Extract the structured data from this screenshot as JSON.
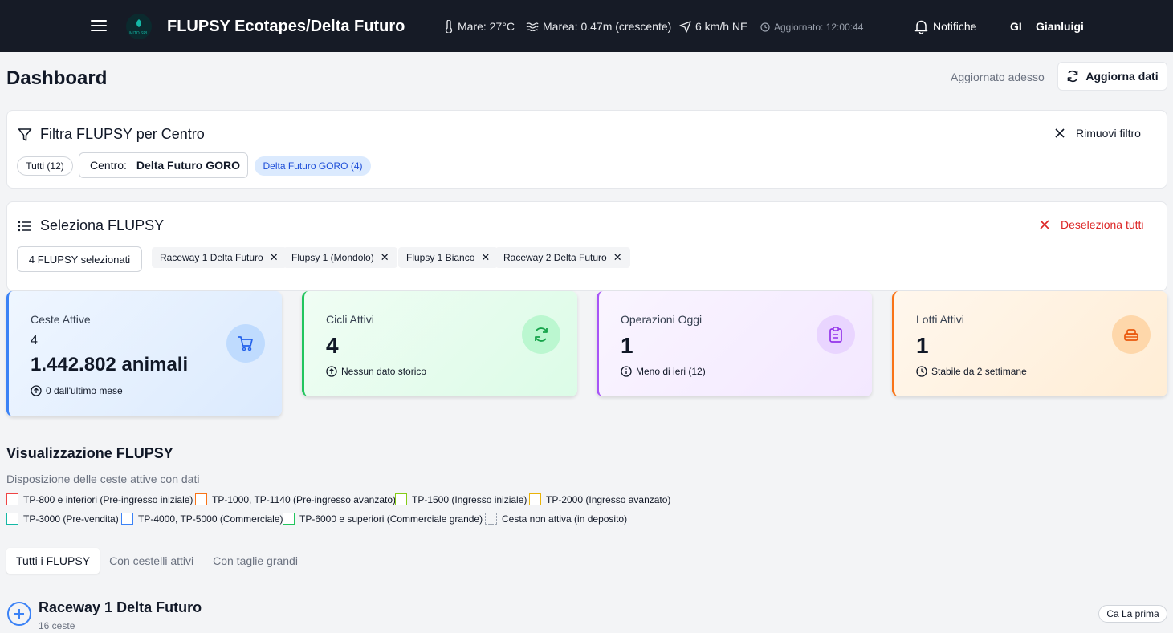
{
  "topbar": {
    "title": "FLUPSY Ecotapes/Delta Futuro",
    "logo_text": "MITO SRL",
    "sea_temp": "Mare: 27°C",
    "tide": "Marea: 0.47m (crescente)",
    "wind": "6 km/h NE",
    "updated": "Aggiornato: 12:00:44",
    "notifications": "Notifiche",
    "user_initials": "GI",
    "user_name": "Gianluigi"
  },
  "header": {
    "title": "Dashboard",
    "updated_now": "Aggiornato adesso",
    "refresh_label": "Aggiorna dati"
  },
  "filter": {
    "title": "Filtra FLUPSY per Centro",
    "remove_label": "Rimuovi filtro",
    "all_label": "Tutti (12)",
    "center_label": "Centro:",
    "center_value": "Delta Futuro GORO",
    "active_badge": "Delta Futuro GORO (4)"
  },
  "select": {
    "title": "Seleziona FLUPSY",
    "deselect_label": "Deseleziona tutti",
    "count_label": "4 FLUPSY selezionati",
    "chips": [
      "Raceway 1 Delta Futuro",
      "Flupsy 1 (Mondolo)",
      "Flupsy 1 Bianco",
      "Raceway 2 Delta Futuro"
    ]
  },
  "stats": {
    "ceste": {
      "label": "Ceste Attive",
      "value": "4",
      "animals": "1.442.802 animali",
      "sub": "0 dall'ultimo mese"
    },
    "cicli": {
      "label": "Cicli Attivi",
      "value": "4",
      "sub": "Nessun dato storico"
    },
    "operazioni": {
      "label": "Operazioni Oggi",
      "value": "1",
      "sub": "Meno di ieri (12)"
    },
    "lotti": {
      "label": "Lotti Attivi",
      "value": "1",
      "sub": "Stabile da 2 settimane"
    }
  },
  "viz": {
    "title": "Visualizzazione FLUPSY",
    "subtitle": "Disposizione delle ceste attive con dati",
    "legend": [
      {
        "label": "TP-800 e inferiori (Pre-ingresso iniziale)",
        "color": "#ef4444"
      },
      {
        "label": "TP-1000, TP-1140 (Pre-ingresso avanzato)",
        "color": "#f97316"
      },
      {
        "label": "TP-1500 (Ingresso iniziale)",
        "color": "#84cc16"
      },
      {
        "label": "TP-2000 (Ingresso avanzato)",
        "color": "#eab308"
      },
      {
        "label": "TP-3000 (Pre-vendita)",
        "color": "#14b8a6"
      },
      {
        "label": "TP-4000, TP-5000 (Commerciale)",
        "color": "#3b82f6"
      },
      {
        "label": "TP-6000 e superiori (Commerciale grande)",
        "color": "#22c55e"
      },
      {
        "label": "Cesta non attiva (in deposito)",
        "color": "#9ca3af"
      }
    ],
    "tabs": [
      "Tutti i FLUPSY",
      "Con cestelli attivi",
      "Con taglie grandi"
    ]
  },
  "raceway": {
    "title": "Raceway 1 Delta Futuro",
    "subtitle": "16 ceste",
    "badge": "Ca La prima"
  }
}
